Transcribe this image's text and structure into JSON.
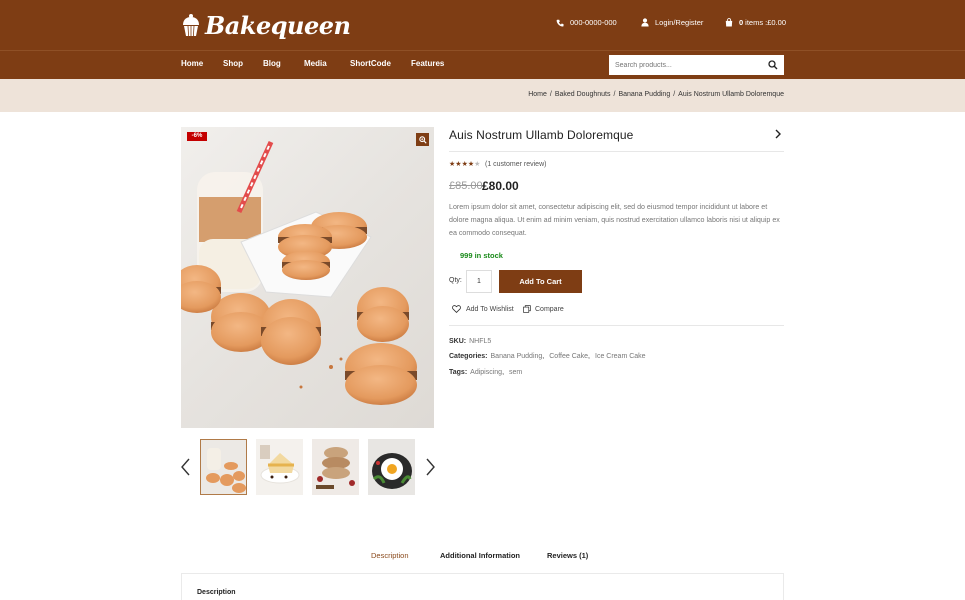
{
  "brand": {
    "name": "Bakequeen",
    "logo_icon": "cupcake-icon"
  },
  "header": {
    "phone": "000-0000-000",
    "login": "Login/Register",
    "cart_count": "0",
    "cart_label": "items :£0.00"
  },
  "nav": {
    "items": [
      "Home",
      "Shop",
      "Blog",
      "Media",
      "ShortCode",
      "Features"
    ]
  },
  "search": {
    "placeholder": "Search products..."
  },
  "breadcrumb": [
    "Home",
    "Baked Doughnuts",
    "Banana Pudding",
    "Auis Nostrum Ullamb Doloremque"
  ],
  "product": {
    "sale_badge": "-6%",
    "title": "Auis Nostrum Ullamb Doloremque",
    "rating": 4,
    "rating_max": 5,
    "review_text": "(1 customer review)",
    "old_price": "£85.00",
    "price": "£80.00",
    "description": "Lorem ipsum dolor sit amet, consectetur adipiscing elit, sed do eiusmod tempor incididunt ut labore et dolore magna aliqua. Ut enim ad minim veniam, quis nostrud exercitation ullamco laboris nisi ut aliquip ex ea commodo consequat.",
    "stock": "999 in stock",
    "qty_label": "Qty:",
    "qty_value": "1",
    "add_to_cart": "Add To Cart",
    "wishlist": "Add To Wishlist",
    "compare": "Compare",
    "sku_label": "SKU:",
    "sku": "NHFL5",
    "categories_label": "Categories:",
    "categories": [
      "Banana Pudding",
      "Coffee Cake",
      "Ice Cream Cake"
    ],
    "tags_label": "Tags:",
    "tags": [
      "Adipiscing",
      "sem"
    ]
  },
  "tabs": {
    "items": [
      "Description",
      "Additional Information",
      "Reviews (1)"
    ],
    "active": "Description",
    "panel_title": "Description"
  },
  "colors": {
    "brand": "#7e3d14",
    "breadcrumb_bg": "#eee3d9",
    "sale": "#c40000",
    "stock": "#1a8a1a"
  }
}
